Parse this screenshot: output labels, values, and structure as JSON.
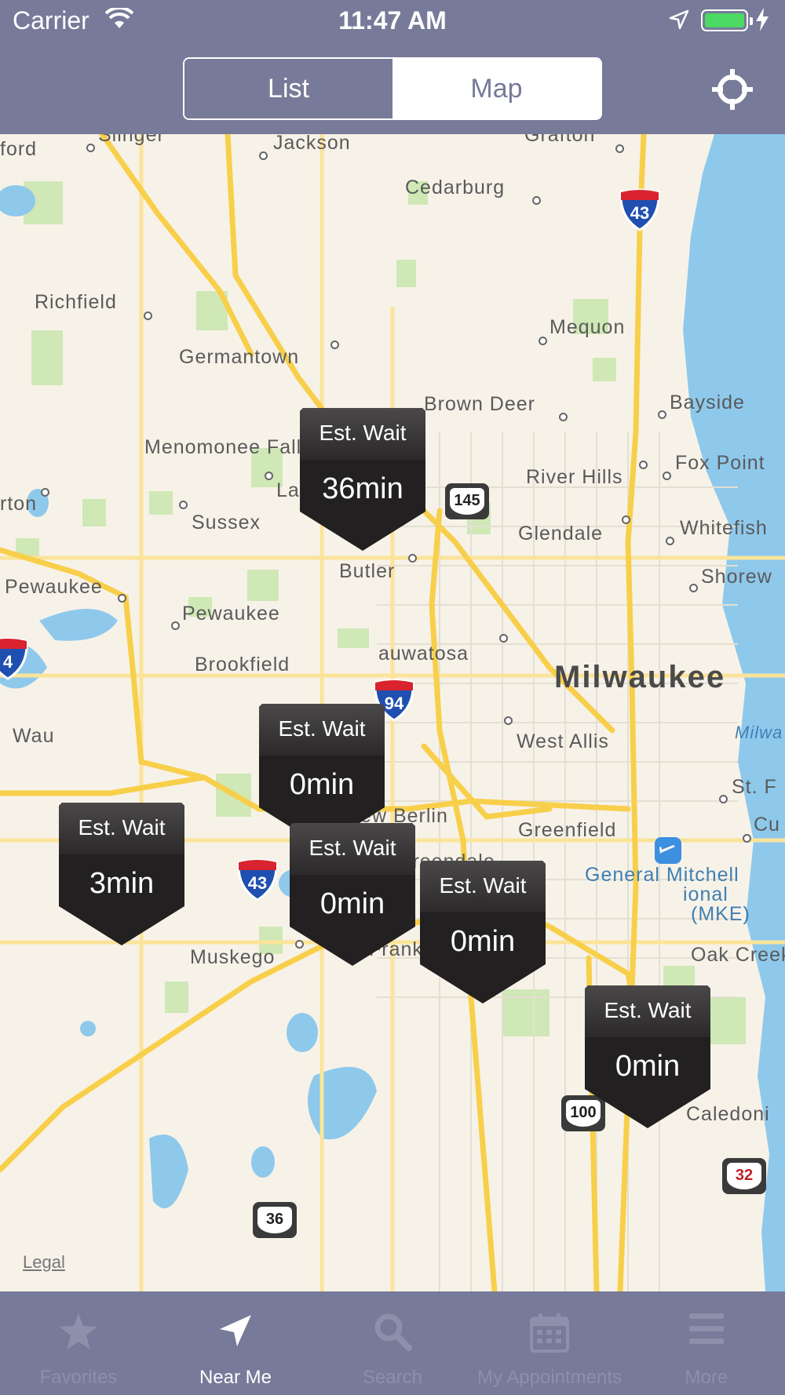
{
  "status_bar": {
    "carrier": "Carrier",
    "time": "11:47 AM",
    "battery_level": 1.0
  },
  "nav": {
    "segment_list": "List",
    "segment_map": "Map",
    "selected_segment": "Map"
  },
  "map": {
    "legal": "Legal",
    "cities": [
      "ford",
      "Slinger",
      "Jackson",
      "Grafton",
      "Cedarburg",
      "Richfield",
      "Mequon",
      "Germantown",
      "Brown Deer",
      "Bayside",
      "Menomonee Falls",
      "River Hills",
      "Fox Point",
      "rton",
      "Lannon",
      "Sussex",
      "Glendale",
      "Whitefish",
      "Butler",
      "Shorew",
      "Pewaukee",
      "Pewaukee",
      "Brookfield",
      "auwatosa",
      "Milwaukee",
      "West Allis",
      "Wau",
      "New Berlin",
      "Greenfield",
      "St. F",
      "Cu",
      "Milwa",
      "Greendale",
      "General Mitchell",
      "ional",
      "(MKE)",
      "Muskego",
      "Franklin",
      "Oak Creek",
      "Caledoni"
    ],
    "highway_shields": [
      "145",
      "43",
      "94",
      "4",
      "43",
      "100",
      "36",
      "32"
    ],
    "pins": [
      {
        "label": "Est. Wait",
        "value": "36min"
      },
      {
        "label": "Est. Wait",
        "value": "0min"
      },
      {
        "label": "Est. Wait",
        "value": "3min"
      },
      {
        "label": "Est. Wait",
        "value": "0min"
      },
      {
        "label": "Est. Wait",
        "value": "0min"
      },
      {
        "label": "Est. Wait",
        "value": "0min"
      }
    ]
  },
  "tabs": [
    {
      "label": "Favorites",
      "icon": "star-icon"
    },
    {
      "label": "Near Me",
      "icon": "location-arrow-icon",
      "selected": true
    },
    {
      "label": "Search",
      "icon": "search-icon"
    },
    {
      "label": "My Appointments",
      "icon": "calendar-icon"
    },
    {
      "label": "More",
      "icon": "menu-icon"
    }
  ],
  "colors": {
    "bar": "#777a98",
    "tab_selected": "#ffffff",
    "tab_inactive": "#8d90aa",
    "water": "#8ec9ec",
    "map_bg": "#f7f2e8",
    "road": "#f8cf4a"
  }
}
